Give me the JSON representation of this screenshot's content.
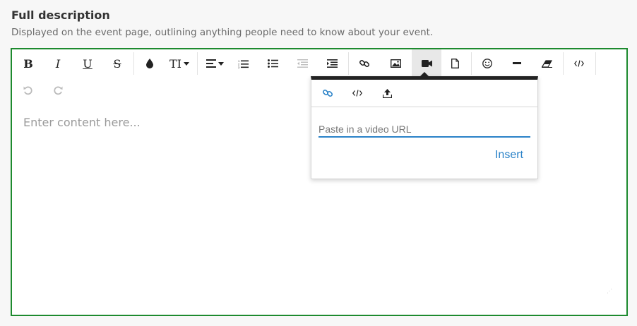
{
  "field": {
    "title": "Full description",
    "description": "Displayed on the event page, outlining anything people need to know about your event."
  },
  "toolbar": {
    "bold": "B",
    "italic": "I",
    "underline": "U",
    "strikethrough": "S",
    "text_size": "TI"
  },
  "editor": {
    "placeholder": "Enter content here..."
  },
  "video_popover": {
    "url_placeholder": "Paste in a video URL",
    "insert_label": "Insert"
  },
  "colors": {
    "border": "#1d8a2e",
    "accent": "#2a82c8"
  }
}
